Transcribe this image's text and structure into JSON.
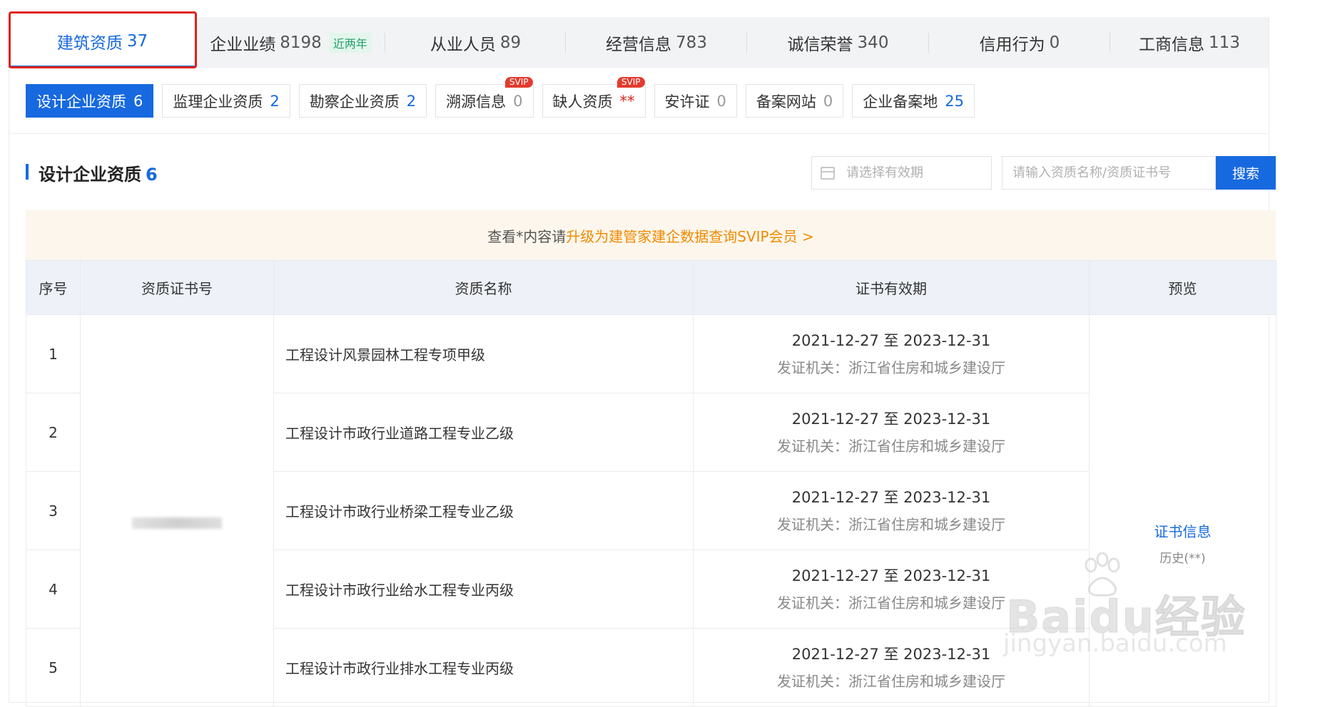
{
  "main_tabs": [
    {
      "label": "建筑资质",
      "count": "37",
      "active": true
    },
    {
      "label": "企业业绩",
      "count": "8198",
      "tag": "近两年"
    },
    {
      "label": "从业人员",
      "count": "89"
    },
    {
      "label": "经营信息",
      "count": "783"
    },
    {
      "label": "诚信荣誉",
      "count": "340"
    },
    {
      "label": "信用行为",
      "count": "0"
    },
    {
      "label": "工商信息",
      "count": "113"
    }
  ],
  "sub_tabs": [
    {
      "label": "设计企业资质",
      "count": "6"
    },
    {
      "label": "监理企业资质",
      "count": "2"
    },
    {
      "label": "勘察企业资质",
      "count": "2"
    },
    {
      "label": "溯源信息",
      "count": "0",
      "badge": "SVIP"
    },
    {
      "label": "缺人资质",
      "count": "**",
      "badge": "SVIP"
    },
    {
      "label": "安许证",
      "count": "0"
    },
    {
      "label": "备案网站",
      "count": "0"
    },
    {
      "label": "企业备案地",
      "count": "25"
    }
  ],
  "section": {
    "title": "设计企业资质",
    "count": "6"
  },
  "filters": {
    "date_placeholder": "请选择有效期",
    "search_placeholder": "请输入资质名称/资质证书号",
    "search_button": "搜索"
  },
  "banner": {
    "prefix": "查看*内容请",
    "link": "升级为建管家建企数据查询SVIP会员 >"
  },
  "table": {
    "headers": [
      "序号",
      "资质证书号",
      "资质名称",
      "证书有效期",
      "预览"
    ],
    "rows": [
      {
        "index": "1",
        "name": "工程设计风景园林工程专项甲级",
        "validity": "2021-12-27 至 2023-12-31",
        "issuer": "发证机关：浙江省住房和城乡建设厅"
      },
      {
        "index": "2",
        "name": "工程设计市政行业道路工程专业乙级",
        "validity": "2021-12-27 至 2023-12-31",
        "issuer": "发证机关：浙江省住房和城乡建设厅"
      },
      {
        "index": "3",
        "name": "工程设计市政行业桥梁工程专业乙级",
        "validity": "2021-12-27 至 2023-12-31",
        "issuer": "发证机关：浙江省住房和城乡建设厅"
      },
      {
        "index": "4",
        "name": "工程设计市政行业给水工程专业丙级",
        "validity": "2021-12-27 至 2023-12-31",
        "issuer": "发证机关：浙江省住房和城乡建设厅"
      },
      {
        "index": "5",
        "name": "工程设计市政行业排水工程专业丙级",
        "validity": "2021-12-27 至 2023-12-31",
        "issuer": "发证机关：浙江省住房和城乡建设厅"
      }
    ],
    "preview_link": "证书信息",
    "preview_history": "历史(**)"
  },
  "watermark": {
    "brand": "Baidu经验",
    "url": "jingyan.baidu.com"
  }
}
